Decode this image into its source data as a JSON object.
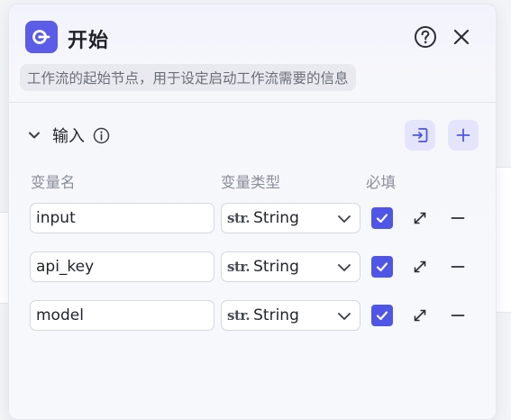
{
  "node": {
    "title": "开始",
    "description": "工作流的起始节点，用于设定启动工作流需要的信息"
  },
  "input_section": {
    "title": "输入"
  },
  "columns": {
    "name": "变量名",
    "type": "变量类型",
    "required": "必填"
  },
  "variables": [
    {
      "name": "input",
      "type_prefix": "str.",
      "type": "String",
      "required": true
    },
    {
      "name": "api_key",
      "type_prefix": "str.",
      "type": "String",
      "required": true
    },
    {
      "name": "model",
      "type_prefix": "str.",
      "type": "String",
      "required": true
    }
  ],
  "colors": {
    "accent": "#5b5ce8",
    "checkbox": "#4f55e6",
    "button_bg": "#e4e5fb"
  },
  "icons": [
    "start-node-icon",
    "help-icon",
    "close-icon",
    "chevron-down-icon",
    "info-icon",
    "import-icon",
    "plus-icon",
    "expand-icon",
    "minus-icon",
    "check-icon"
  ]
}
